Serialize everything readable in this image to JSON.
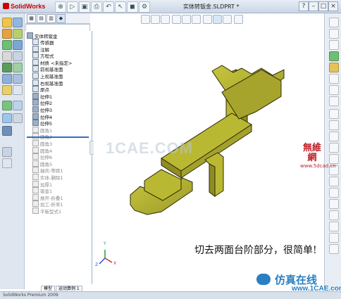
{
  "app": {
    "logo_text": "SolidWorks",
    "document_title": "实体转钣金.SLDPRT *"
  },
  "window_buttons": [
    "?",
    "–",
    "□",
    "×"
  ],
  "toolbar": {
    "new": "⊕",
    "open": "▷",
    "save": "▣",
    "print": "⎙",
    "undo": "↶",
    "select": "↖",
    "rebuild": "◼",
    "options": "⚙"
  },
  "feature_tree": {
    "root": "实体转钣金",
    "items": [
      {
        "label": "传感器",
        "suppressed": false
      },
      {
        "label": "注解",
        "suppressed": false
      },
      {
        "label": "方程式",
        "suppressed": false
      },
      {
        "label": "材质 <未指定>",
        "suppressed": false
      },
      {
        "label": "前视基准面",
        "suppressed": false
      },
      {
        "label": "上视基准面",
        "suppressed": false
      },
      {
        "label": "右视基准面",
        "suppressed": false
      },
      {
        "label": "原点",
        "suppressed": false
      },
      {
        "label": "拉伸1",
        "suppressed": false
      },
      {
        "label": "拉伸2",
        "suppressed": false
      },
      {
        "label": "拉伸3",
        "suppressed": false
      },
      {
        "label": "拉伸4",
        "suppressed": false
      },
      {
        "label": "拉伸5",
        "suppressed": false
      },
      {
        "label": "圆角1",
        "suppressed": true
      },
      {
        "label": "圆角2",
        "suppressed": true
      },
      {
        "label": "圆角3",
        "suppressed": true
      },
      {
        "label": "圆角4",
        "suppressed": true
      },
      {
        "label": "拉伸6",
        "suppressed": true
      },
      {
        "label": "圆角5",
        "suppressed": true
      },
      {
        "label": "抽壳-等距1",
        "suppressed": true
      },
      {
        "label": "实体-删除1",
        "suppressed": true
      },
      {
        "label": "加厚1",
        "suppressed": true
      },
      {
        "label": "钣金1",
        "suppressed": true
      },
      {
        "label": "展开-折叠1",
        "suppressed": true
      },
      {
        "label": "加工-折弯1",
        "suppressed": true
      },
      {
        "label": "平板型式1",
        "suppressed": true
      }
    ]
  },
  "viewport": {
    "caption": "切去两面台阶部分，很简单!",
    "center_watermark": "1CAE.COM",
    "part_color": "#b9b832",
    "part_shade": "#8f8c23",
    "part_edge": "#2d2a06",
    "triad": {
      "x": "X",
      "y": "Y",
      "z": "Z"
    }
  },
  "stamp": {
    "title": "無維網",
    "url": "www.5dcad.cn"
  },
  "brand": {
    "title": "仿真在线",
    "url": "www.1CAE.com"
  },
  "bottom_tabs": [
    "模型",
    "运动算例 1"
  ],
  "status": {
    "text": "SolidWorks Premium 2009"
  }
}
